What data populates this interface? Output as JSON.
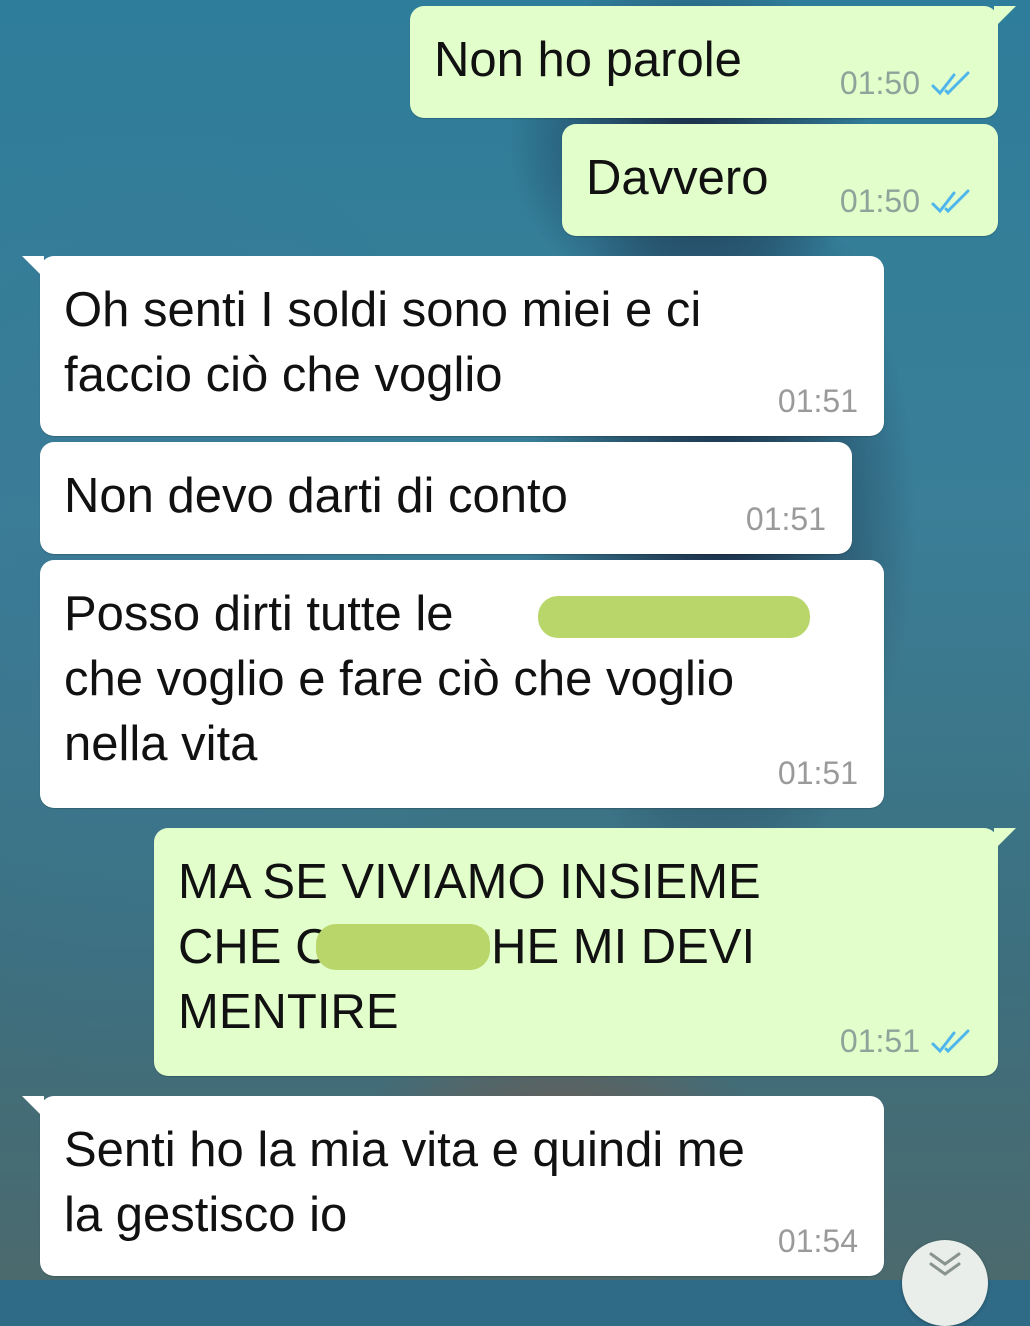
{
  "chat": {
    "messages": [
      {
        "direction": "out",
        "text": "Non ho parole",
        "time": "01:50",
        "status": "read"
      },
      {
        "direction": "out",
        "text": "Davvero",
        "time": "01:50",
        "status": "read"
      },
      {
        "direction": "in",
        "text": "Oh senti I soldi sono miei e ci\nfaccio ciò che voglio",
        "time": "01:51"
      },
      {
        "direction": "in",
        "text": "Non devo darti di conto",
        "time": "01:51"
      },
      {
        "direction": "in",
        "text": "Posso dirti tutte le\nche voglio e fare ciò che voglio\nnella vita",
        "time": "01:51"
      },
      {
        "direction": "out",
        "text": "MA SE VIVIAMO INSIEME\nCHE C              DICI CHE MI DEVI\nMENTIRE",
        "time": "01:51",
        "status": "read"
      },
      {
        "direction": "in",
        "text": "Senti ho la mia vita e quindi me\nla gestisco io",
        "time": "01:54"
      }
    ]
  },
  "colors": {
    "outgoing_bubble": "#e2fecb",
    "incoming_bubble": "#ffffff",
    "read_ticks": "#4fb6ec",
    "censor_mark": "#b9d66a"
  },
  "icons": {
    "read_status": "double-check-icon",
    "scroll_down": "double-chevron-down-icon"
  }
}
